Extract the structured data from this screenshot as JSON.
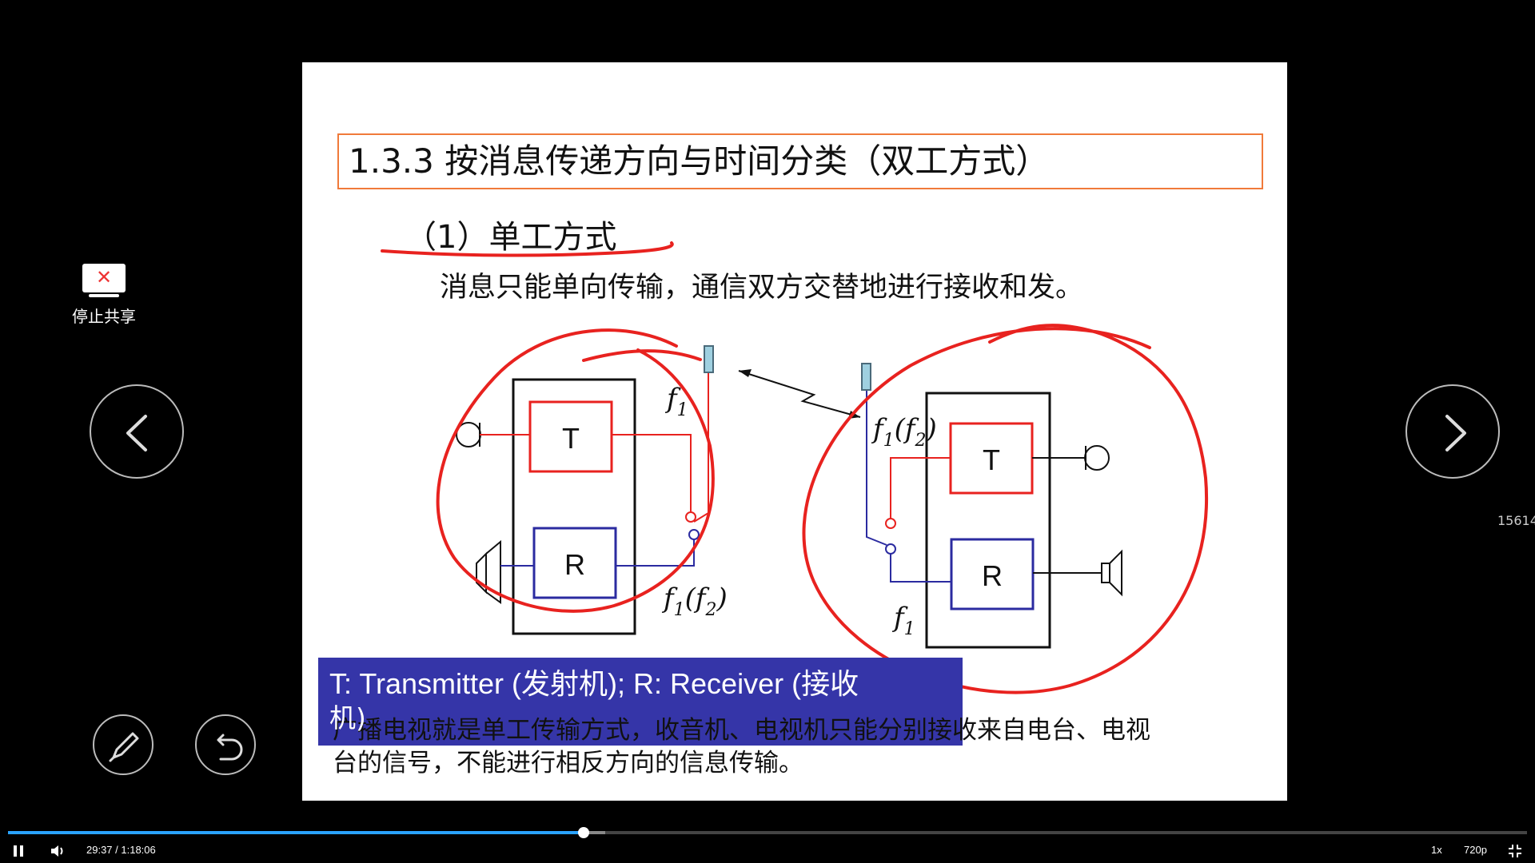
{
  "slide": {
    "title": "1.3.3  按消息传递方向与时间分类（双工方式）",
    "section": "（1）单工方式",
    "description": "消息只能单向传输，通信双方交替地进行接收和发。",
    "left_diagram": {
      "t": "T",
      "r": "R",
      "f_top": "f",
      "f_top_sub": "1",
      "f_bot": "f",
      "f_bot_sub": "1",
      "f_bot_par": "(f",
      "f_bot_par_sub": "2",
      "f_bot_close": ")"
    },
    "right_diagram": {
      "t": "T",
      "r": "R",
      "f_top": "f",
      "f_top_sub": "1",
      "f_top_par": "(f",
      "f_top_par_sub": "2",
      "f_top_close": ")",
      "f_bot": "f",
      "f_bot_sub": "1"
    },
    "caption_line1": "T: Transmitter (发射机);   R: Receiver (接收",
    "caption_line2": "机)",
    "bottom_line1": "广播电视就是单工传输方式，收音机、电视机只能分别接收来自电台、电视",
    "bottom_line2": "台的信号，不能进行相反方向的信息传输。"
  },
  "sidebar": {
    "stop_share_label": "停止共享",
    "side_number": "15614"
  },
  "player": {
    "time": "29:37 / 1:18:06",
    "speed": "1x",
    "quality": "720p",
    "progress_fraction": 0.379,
    "buffer_fraction": 0.393
  },
  "colors": {
    "annotation": "#e8221f",
    "transmitter": "#e8221f",
    "receiver": "#2b2ba0",
    "caption_bg": "#3535a8",
    "title_border": "#f07a3a",
    "progress": "#2aa3ff"
  },
  "icons": [
    "stop-share-icon",
    "prev-slide-icon",
    "next-slide-icon",
    "pen-icon",
    "undo-icon",
    "pause-icon",
    "volume-icon",
    "exit-fullscreen-icon"
  ]
}
